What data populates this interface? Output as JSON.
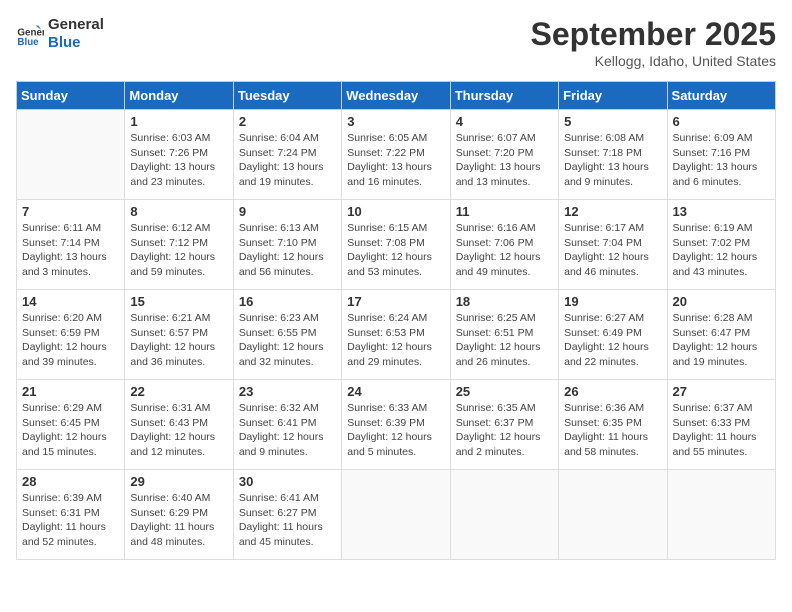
{
  "header": {
    "logo_line1": "General",
    "logo_line2": "Blue",
    "title": "September 2025",
    "location": "Kellogg, Idaho, United States"
  },
  "days_of_week": [
    "Sunday",
    "Monday",
    "Tuesday",
    "Wednesday",
    "Thursday",
    "Friday",
    "Saturday"
  ],
  "weeks": [
    [
      {
        "day": "",
        "info": ""
      },
      {
        "day": "1",
        "info": "Sunrise: 6:03 AM\nSunset: 7:26 PM\nDaylight: 13 hours\nand 23 minutes."
      },
      {
        "day": "2",
        "info": "Sunrise: 6:04 AM\nSunset: 7:24 PM\nDaylight: 13 hours\nand 19 minutes."
      },
      {
        "day": "3",
        "info": "Sunrise: 6:05 AM\nSunset: 7:22 PM\nDaylight: 13 hours\nand 16 minutes."
      },
      {
        "day": "4",
        "info": "Sunrise: 6:07 AM\nSunset: 7:20 PM\nDaylight: 13 hours\nand 13 minutes."
      },
      {
        "day": "5",
        "info": "Sunrise: 6:08 AM\nSunset: 7:18 PM\nDaylight: 13 hours\nand 9 minutes."
      },
      {
        "day": "6",
        "info": "Sunrise: 6:09 AM\nSunset: 7:16 PM\nDaylight: 13 hours\nand 6 minutes."
      }
    ],
    [
      {
        "day": "7",
        "info": "Sunrise: 6:11 AM\nSunset: 7:14 PM\nDaylight: 13 hours\nand 3 minutes."
      },
      {
        "day": "8",
        "info": "Sunrise: 6:12 AM\nSunset: 7:12 PM\nDaylight: 12 hours\nand 59 minutes."
      },
      {
        "day": "9",
        "info": "Sunrise: 6:13 AM\nSunset: 7:10 PM\nDaylight: 12 hours\nand 56 minutes."
      },
      {
        "day": "10",
        "info": "Sunrise: 6:15 AM\nSunset: 7:08 PM\nDaylight: 12 hours\nand 53 minutes."
      },
      {
        "day": "11",
        "info": "Sunrise: 6:16 AM\nSunset: 7:06 PM\nDaylight: 12 hours\nand 49 minutes."
      },
      {
        "day": "12",
        "info": "Sunrise: 6:17 AM\nSunset: 7:04 PM\nDaylight: 12 hours\nand 46 minutes."
      },
      {
        "day": "13",
        "info": "Sunrise: 6:19 AM\nSunset: 7:02 PM\nDaylight: 12 hours\nand 43 minutes."
      }
    ],
    [
      {
        "day": "14",
        "info": "Sunrise: 6:20 AM\nSunset: 6:59 PM\nDaylight: 12 hours\nand 39 minutes."
      },
      {
        "day": "15",
        "info": "Sunrise: 6:21 AM\nSunset: 6:57 PM\nDaylight: 12 hours\nand 36 minutes."
      },
      {
        "day": "16",
        "info": "Sunrise: 6:23 AM\nSunset: 6:55 PM\nDaylight: 12 hours\nand 32 minutes."
      },
      {
        "day": "17",
        "info": "Sunrise: 6:24 AM\nSunset: 6:53 PM\nDaylight: 12 hours\nand 29 minutes."
      },
      {
        "day": "18",
        "info": "Sunrise: 6:25 AM\nSunset: 6:51 PM\nDaylight: 12 hours\nand 26 minutes."
      },
      {
        "day": "19",
        "info": "Sunrise: 6:27 AM\nSunset: 6:49 PM\nDaylight: 12 hours\nand 22 minutes."
      },
      {
        "day": "20",
        "info": "Sunrise: 6:28 AM\nSunset: 6:47 PM\nDaylight: 12 hours\nand 19 minutes."
      }
    ],
    [
      {
        "day": "21",
        "info": "Sunrise: 6:29 AM\nSunset: 6:45 PM\nDaylight: 12 hours\nand 15 minutes."
      },
      {
        "day": "22",
        "info": "Sunrise: 6:31 AM\nSunset: 6:43 PM\nDaylight: 12 hours\nand 12 minutes."
      },
      {
        "day": "23",
        "info": "Sunrise: 6:32 AM\nSunset: 6:41 PM\nDaylight: 12 hours\nand 9 minutes."
      },
      {
        "day": "24",
        "info": "Sunrise: 6:33 AM\nSunset: 6:39 PM\nDaylight: 12 hours\nand 5 minutes."
      },
      {
        "day": "25",
        "info": "Sunrise: 6:35 AM\nSunset: 6:37 PM\nDaylight: 12 hours\nand 2 minutes."
      },
      {
        "day": "26",
        "info": "Sunrise: 6:36 AM\nSunset: 6:35 PM\nDaylight: 11 hours\nand 58 minutes."
      },
      {
        "day": "27",
        "info": "Sunrise: 6:37 AM\nSunset: 6:33 PM\nDaylight: 11 hours\nand 55 minutes."
      }
    ],
    [
      {
        "day": "28",
        "info": "Sunrise: 6:39 AM\nSunset: 6:31 PM\nDaylight: 11 hours\nand 52 minutes."
      },
      {
        "day": "29",
        "info": "Sunrise: 6:40 AM\nSunset: 6:29 PM\nDaylight: 11 hours\nand 48 minutes."
      },
      {
        "day": "30",
        "info": "Sunrise: 6:41 AM\nSunset: 6:27 PM\nDaylight: 11 hours\nand 45 minutes."
      },
      {
        "day": "",
        "info": ""
      },
      {
        "day": "",
        "info": ""
      },
      {
        "day": "",
        "info": ""
      },
      {
        "day": "",
        "info": ""
      }
    ]
  ]
}
